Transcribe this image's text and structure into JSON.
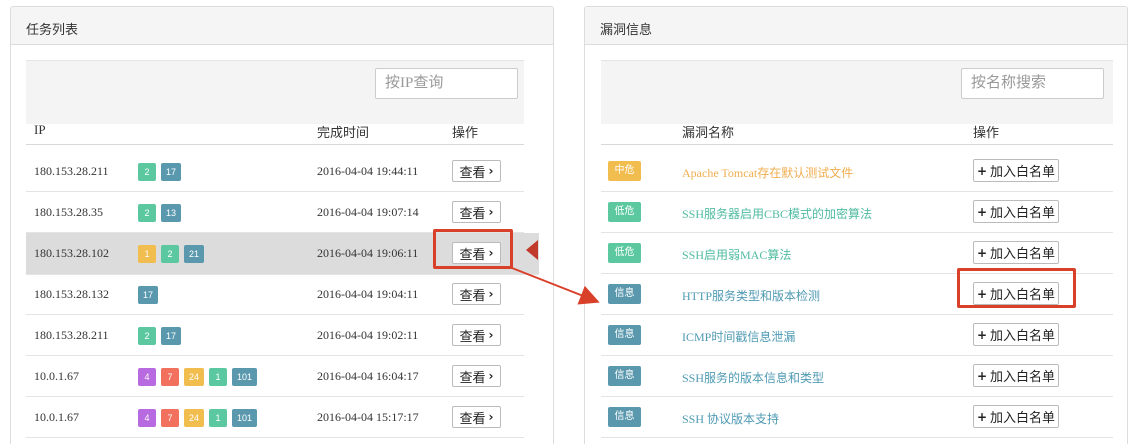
{
  "task_panel": {
    "title": "任务列表",
    "search": {
      "placeholder": "按IP查询",
      "value": ""
    },
    "columns": {
      "ip": "IP",
      "finish_time": "完成时间",
      "action": "操作"
    },
    "rows": [
      {
        "ip": "180.153.28.211",
        "badges": [
          {
            "value": "2",
            "color": "green"
          },
          {
            "value": "17",
            "color": "teal"
          }
        ],
        "time": "2016-04-04 19:44:11",
        "action": "查看"
      },
      {
        "ip": "180.153.28.35",
        "badges": [
          {
            "value": "2",
            "color": "green"
          },
          {
            "value": "13",
            "color": "teal"
          }
        ],
        "time": "2016-04-04 19:07:14",
        "action": "查看"
      },
      {
        "ip": "180.153.28.102",
        "badges": [
          {
            "value": "1",
            "color": "yellow"
          },
          {
            "value": "2",
            "color": "green"
          },
          {
            "value": "21",
            "color": "teal"
          }
        ],
        "time": "2016-04-04 19:06:11",
        "action": "查看",
        "selected": true
      },
      {
        "ip": "180.153.28.132",
        "badges": [
          {
            "value": "17",
            "color": "teal"
          }
        ],
        "time": "2016-04-04 19:04:11",
        "action": "查看"
      },
      {
        "ip": "180.153.28.211",
        "badges": [
          {
            "value": "2",
            "color": "green"
          },
          {
            "value": "17",
            "color": "teal"
          }
        ],
        "time": "2016-04-04 19:02:11",
        "action": "查看"
      },
      {
        "ip": "10.0.1.67",
        "badges": [
          {
            "value": "4",
            "color": "purple"
          },
          {
            "value": "7",
            "color": "red"
          },
          {
            "value": "24",
            "color": "yellow"
          },
          {
            "value": "1",
            "color": "green"
          },
          {
            "value": "101",
            "color": "teal"
          }
        ],
        "time": "2016-04-04 16:04:17",
        "action": "查看"
      },
      {
        "ip": "10.0.1.67",
        "badges": [
          {
            "value": "4",
            "color": "purple"
          },
          {
            "value": "7",
            "color": "red"
          },
          {
            "value": "24",
            "color": "yellow"
          },
          {
            "value": "1",
            "color": "green"
          },
          {
            "value": "101",
            "color": "teal"
          }
        ],
        "time": "2016-04-04 15:17:17",
        "action": "查看"
      }
    ]
  },
  "vuln_panel": {
    "title": "漏洞信息",
    "search": {
      "placeholder": "按名称搜索",
      "value": ""
    },
    "columns": {
      "name": "漏洞名称",
      "action": "操作"
    },
    "rows": [
      {
        "level": "中危",
        "level_class": "mid",
        "name": "Apache Tomcat存在默认测试文件",
        "action": "加入白名单"
      },
      {
        "level": "低危",
        "level_class": "low",
        "name": "SSH服务器启用CBC模式的加密算法",
        "action": "加入白名单"
      },
      {
        "level": "低危",
        "level_class": "low",
        "name": "SSH启用弱MAC算法",
        "action": "加入白名单"
      },
      {
        "level": "信息",
        "level_class": "info",
        "name": "HTTP服务类型和版本检测",
        "action": "加入白名单",
        "highlighted": true
      },
      {
        "level": "信息",
        "level_class": "info",
        "name": "ICMP时间戳信息泄漏",
        "action": "加入白名单"
      },
      {
        "level": "信息",
        "level_class": "info",
        "name": "SSH服务的版本信息和类型",
        "action": "加入白名单"
      },
      {
        "level": "信息",
        "level_class": "info",
        "name": "SSH 协议版本支持",
        "action": "加入白名单"
      }
    ]
  },
  "colors": {
    "purple": "#b86be0",
    "red": "#f2705e",
    "yellow": "#f2bd4f",
    "green": "#5cc8a0",
    "teal": "#5a98ae",
    "highlight": "#d9402a"
  }
}
